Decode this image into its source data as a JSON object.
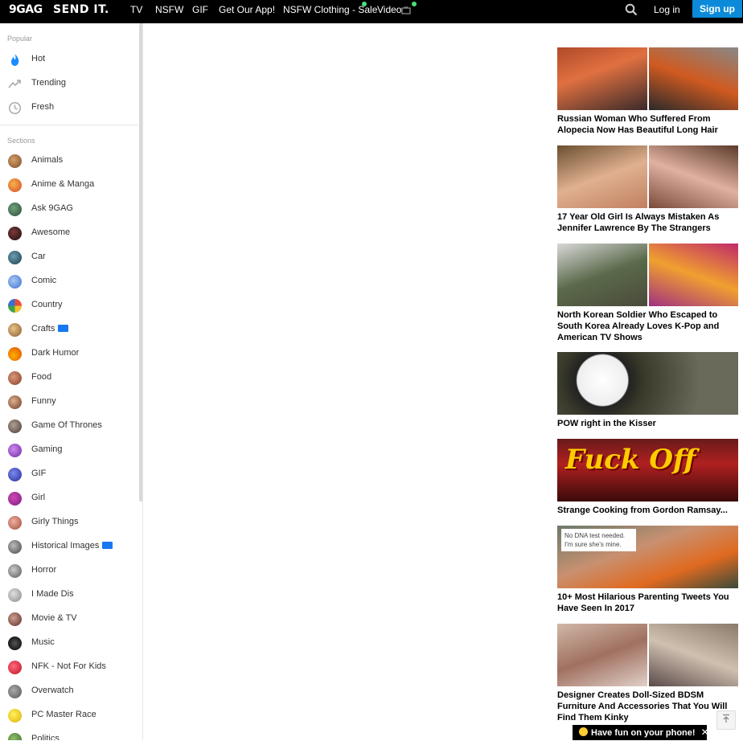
{
  "header": {
    "logo": "9GAG",
    "slogan": "SEND IT.",
    "nav": [
      "TV",
      "NSFW",
      "GIF",
      "Get Our App!",
      "NSFW Clothing - Sale",
      "Video"
    ],
    "login": "Log in",
    "signup": "Sign up"
  },
  "sidebar": {
    "popular_title": "Popular",
    "popular": [
      "Hot",
      "Trending",
      "Fresh"
    ],
    "sections_title": "Sections",
    "sections": [
      "Animals",
      "Anime & Manga",
      "Ask 9GAG",
      "Awesome",
      "Car",
      "Comic",
      "Country",
      "Crafts",
      "Dark Humor",
      "Food",
      "Funny",
      "Game Of Thrones",
      "Gaming",
      "GIF",
      "Girl",
      "Girly Things",
      "Historical Images",
      "Horror",
      "I Made Dis",
      "Movie & TV",
      "Music",
      "NFK - Not For Kids",
      "Overwatch",
      "PC Master Race",
      "Politics"
    ]
  },
  "cards": [
    "Russian Woman Who Suffered From Alopecia Now Has Beautiful Long Hair",
    "17 Year Old Girl Is Always Mistaken As Jennifer Lawrence By The Strangers",
    "North Korean Soldier Who Escaped to South Korea Already Loves K-Pop and American TV Shows",
    "POW right in the Kisser",
    "Strange Cooking from Gordon Ramsay...",
    "10+ Most Hilarious Parenting Tweets You Have Seen In 2017",
    "Designer Creates Doll-Sized BDSM Furniture And Accessories That You Will Find Them Kinky"
  ],
  "tweet_snippet": "No DNA test needed. I'm sure she's mine.",
  "toast": "Have fun on your phone!"
}
